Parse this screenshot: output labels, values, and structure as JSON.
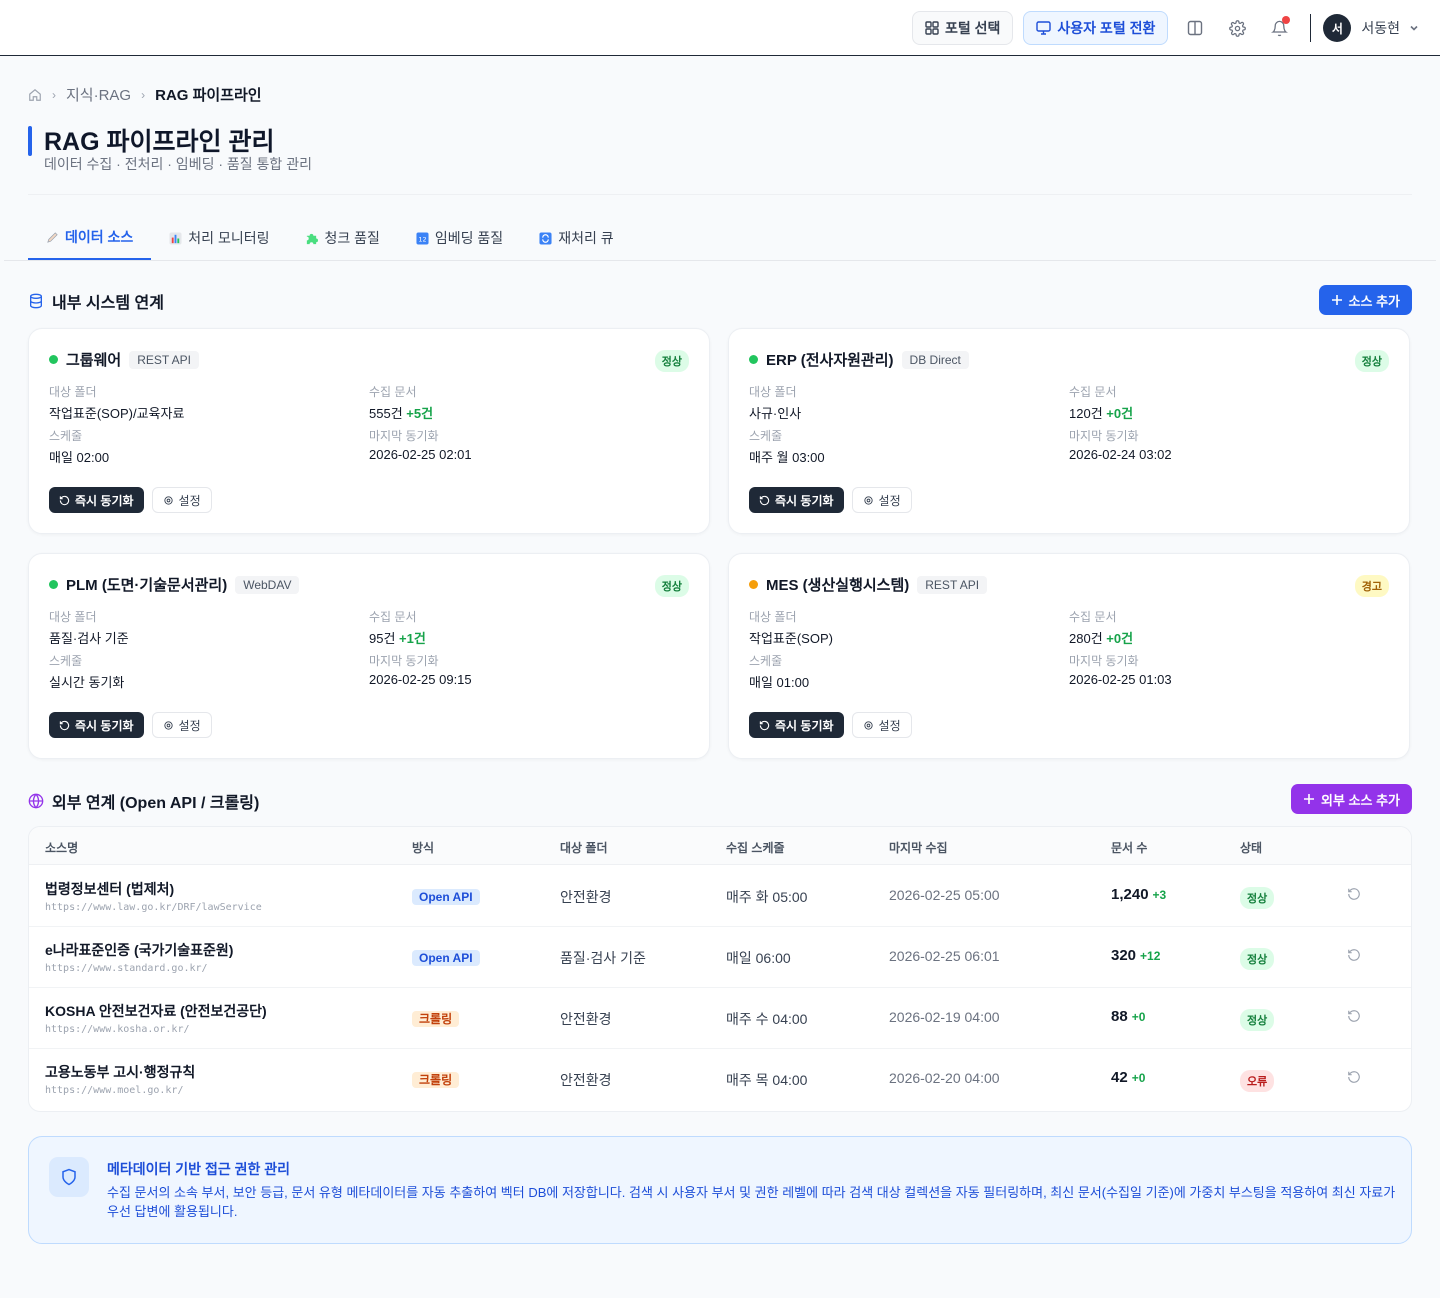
{
  "topbar": {
    "portal_select": "포털 선택",
    "portal_switch": "사용자 포털 전환",
    "user_initial": "서",
    "user_name": "서동현"
  },
  "breadcrumb": [
    "지식·RAG",
    "RAG 파이프라인"
  ],
  "page": {
    "title": "RAG 파이프라인 관리",
    "subtitle": "데이터 수집 · 전처리 · 임베딩 · 품질 통합 관리"
  },
  "tabs": [
    {
      "label": "데이터 소스",
      "icon": "pen-icon"
    },
    {
      "label": "처리 모니터링",
      "icon": "bar-chart-icon"
    },
    {
      "label": "청크 품질",
      "icon": "puzzle-icon"
    },
    {
      "label": "임베딩 품질",
      "icon": "numbers-icon"
    },
    {
      "label": "재처리 큐",
      "icon": "repeat-icon"
    }
  ],
  "internal": {
    "title": "내부 시스템 연계",
    "add_label": "소스 추가",
    "labels": {
      "folder": "대상 폴더",
      "docs": "수집 문서",
      "schedule": "스케줄",
      "last_sync": "마지막 동기화",
      "sync_btn": "즉시 동기화",
      "settings_btn": "설정"
    },
    "sources": [
      {
        "name": "그룹웨어",
        "type": "REST API",
        "status": "정상",
        "status_color": "#22c55e",
        "folder": "작업표준(SOP)/교육자료",
        "docs": "555건",
        "delta": "+5건",
        "schedule": "매일 02:00",
        "last_sync": "2026-02-25 02:01"
      },
      {
        "name": "ERP (전사자원관리)",
        "type": "DB Direct",
        "status": "정상",
        "status_color": "#22c55e",
        "folder": "사규·인사",
        "docs": "120건",
        "delta": "+0건",
        "schedule": "매주 월 03:00",
        "last_sync": "2026-02-24 03:02"
      },
      {
        "name": "PLM (도면·기술문서관리)",
        "type": "WebDAV",
        "status": "정상",
        "status_color": "#22c55e",
        "folder": "품질·검사 기준",
        "docs": "95건",
        "delta": "+1건",
        "schedule": "실시간 동기화",
        "last_sync": "2026-02-25 09:15"
      },
      {
        "name": "MES (생산실행시스템)",
        "type": "REST API",
        "status": "경고",
        "status_color": "#f59e0b",
        "folder": "작업표준(SOP)",
        "docs": "280건",
        "delta": "+0건",
        "schedule": "매일 01:00",
        "last_sync": "2026-02-25 01:03"
      }
    ]
  },
  "external": {
    "title": "외부 연계 (Open API / 크롤링)",
    "add_label": "외부 소스 추가",
    "columns": [
      "소스명",
      "방식",
      "대상 폴더",
      "수집 스케줄",
      "마지막 수집",
      "문서 수",
      "상태"
    ],
    "rows": [
      {
        "name": "법령정보센터 (법제처)",
        "url": "https://www.law.go.kr/DRF/lawService",
        "method": "Open API",
        "folder": "안전환경",
        "schedule": "매주 화 05:00",
        "last": "2026-02-25 05:00",
        "count": "1,240",
        "delta": "+3",
        "status": "정상"
      },
      {
        "name": "e나라표준인증 (국가기술표준원)",
        "url": "https://www.standard.go.kr/",
        "method": "Open API",
        "folder": "품질·검사 기준",
        "schedule": "매일 06:00",
        "last": "2026-02-25 06:01",
        "count": "320",
        "delta": "+12",
        "status": "정상"
      },
      {
        "name": "KOSHA 안전보건자료 (안전보건공단)",
        "url": "https://www.kosha.or.kr/",
        "method": "크롤링",
        "folder": "안전환경",
        "schedule": "매주 수 04:00",
        "last": "2026-02-19 04:00",
        "count": "88",
        "delta": "+0",
        "status": "정상"
      },
      {
        "name": "고용노동부 고시·행정규칙",
        "url": "https://www.moel.go.kr/",
        "method": "크롤링",
        "folder": "안전환경",
        "schedule": "매주 목 04:00",
        "last": "2026-02-20 04:00",
        "count": "42",
        "delta": "+0",
        "status": "오류"
      }
    ]
  },
  "info": {
    "title": "메타데이터 기반 접근 권한 관리",
    "body": "수집 문서의 소속 부서, 보안 등급, 문서 유형 메타데이터를 자동 추출하여 벡터 DB에 저장합니다. 검색 시 사용자 부서 및 권한 레벨에 따라 검색 대상 컬렉션을 자동 필터링하며, 최신 문서(수집일 기준)에 가중치 부스팅을 적용하여 최신 자료가 우선 답변에 활용됩니다."
  }
}
